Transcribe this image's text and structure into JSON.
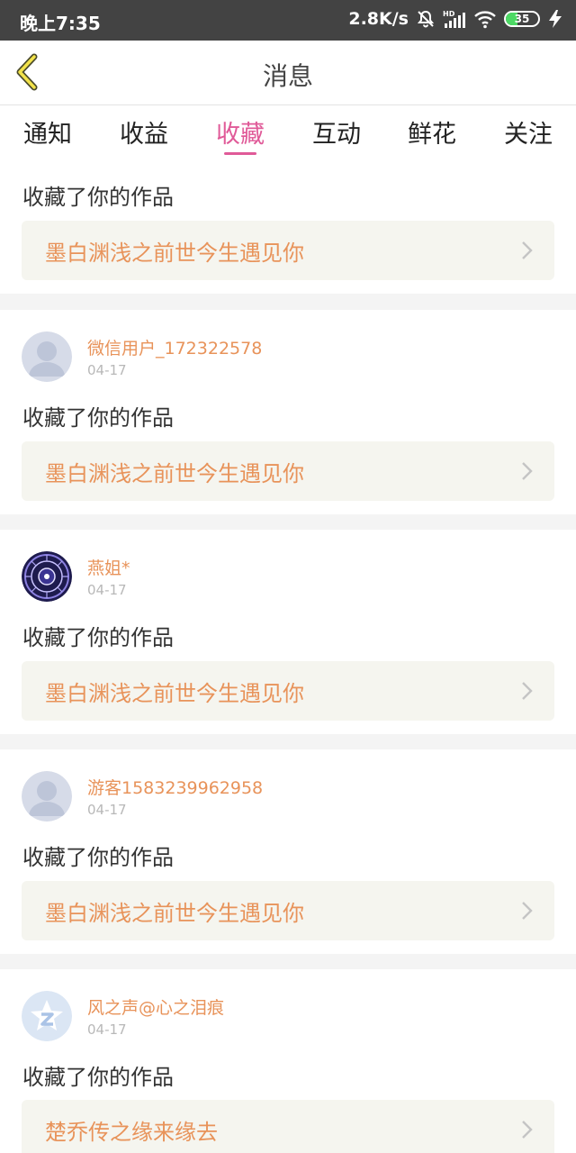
{
  "status_bar": {
    "time": "晚上7:35",
    "network_speed": "2.8K/s",
    "battery_level": "35",
    "icons": [
      "mute-bell-icon",
      "hd-signal-icon",
      "wifi-icon",
      "battery-icon",
      "charging-icon"
    ]
  },
  "header": {
    "title": "消息",
    "back_icon": "chevron-left-icon"
  },
  "tabs": [
    {
      "label": "通知",
      "active": false
    },
    {
      "label": "收益",
      "active": false
    },
    {
      "label": "收藏",
      "active": true
    },
    {
      "label": "互动",
      "active": false
    },
    {
      "label": "鲜花",
      "active": false
    },
    {
      "label": "关注",
      "active": false
    }
  ],
  "colors": {
    "accent_pink": "#e05a98",
    "accent_orange": "#e8935a",
    "status_bar": "#434343"
  },
  "feed": {
    "partial_item": {
      "action": "收藏了你的作品",
      "work_title": "墨白渊浅之前世今生遇见你"
    },
    "items": [
      {
        "username": "微信用户_172322578",
        "date": "04-17",
        "avatar": "default-user-avatar",
        "action": "收藏了你的作品",
        "work_title": "墨白渊浅之前世今生遇见你"
      },
      {
        "username": "燕姐*",
        "date": "04-17",
        "avatar": "zodiac-wheel-avatar",
        "action": "收藏了你的作品",
        "work_title": "墨白渊浅之前世今生遇见你"
      },
      {
        "username": "游客1583239962958",
        "date": "04-17",
        "avatar": "default-user-avatar",
        "action": "收藏了你的作品",
        "work_title": "墨白渊浅之前世今生遇见你"
      },
      {
        "username": "风之声@心之泪痕",
        "date": "04-17",
        "avatar": "qq-star-avatar",
        "action": "收藏了你的作品",
        "work_title": "楚乔传之缘来缘去"
      }
    ]
  }
}
